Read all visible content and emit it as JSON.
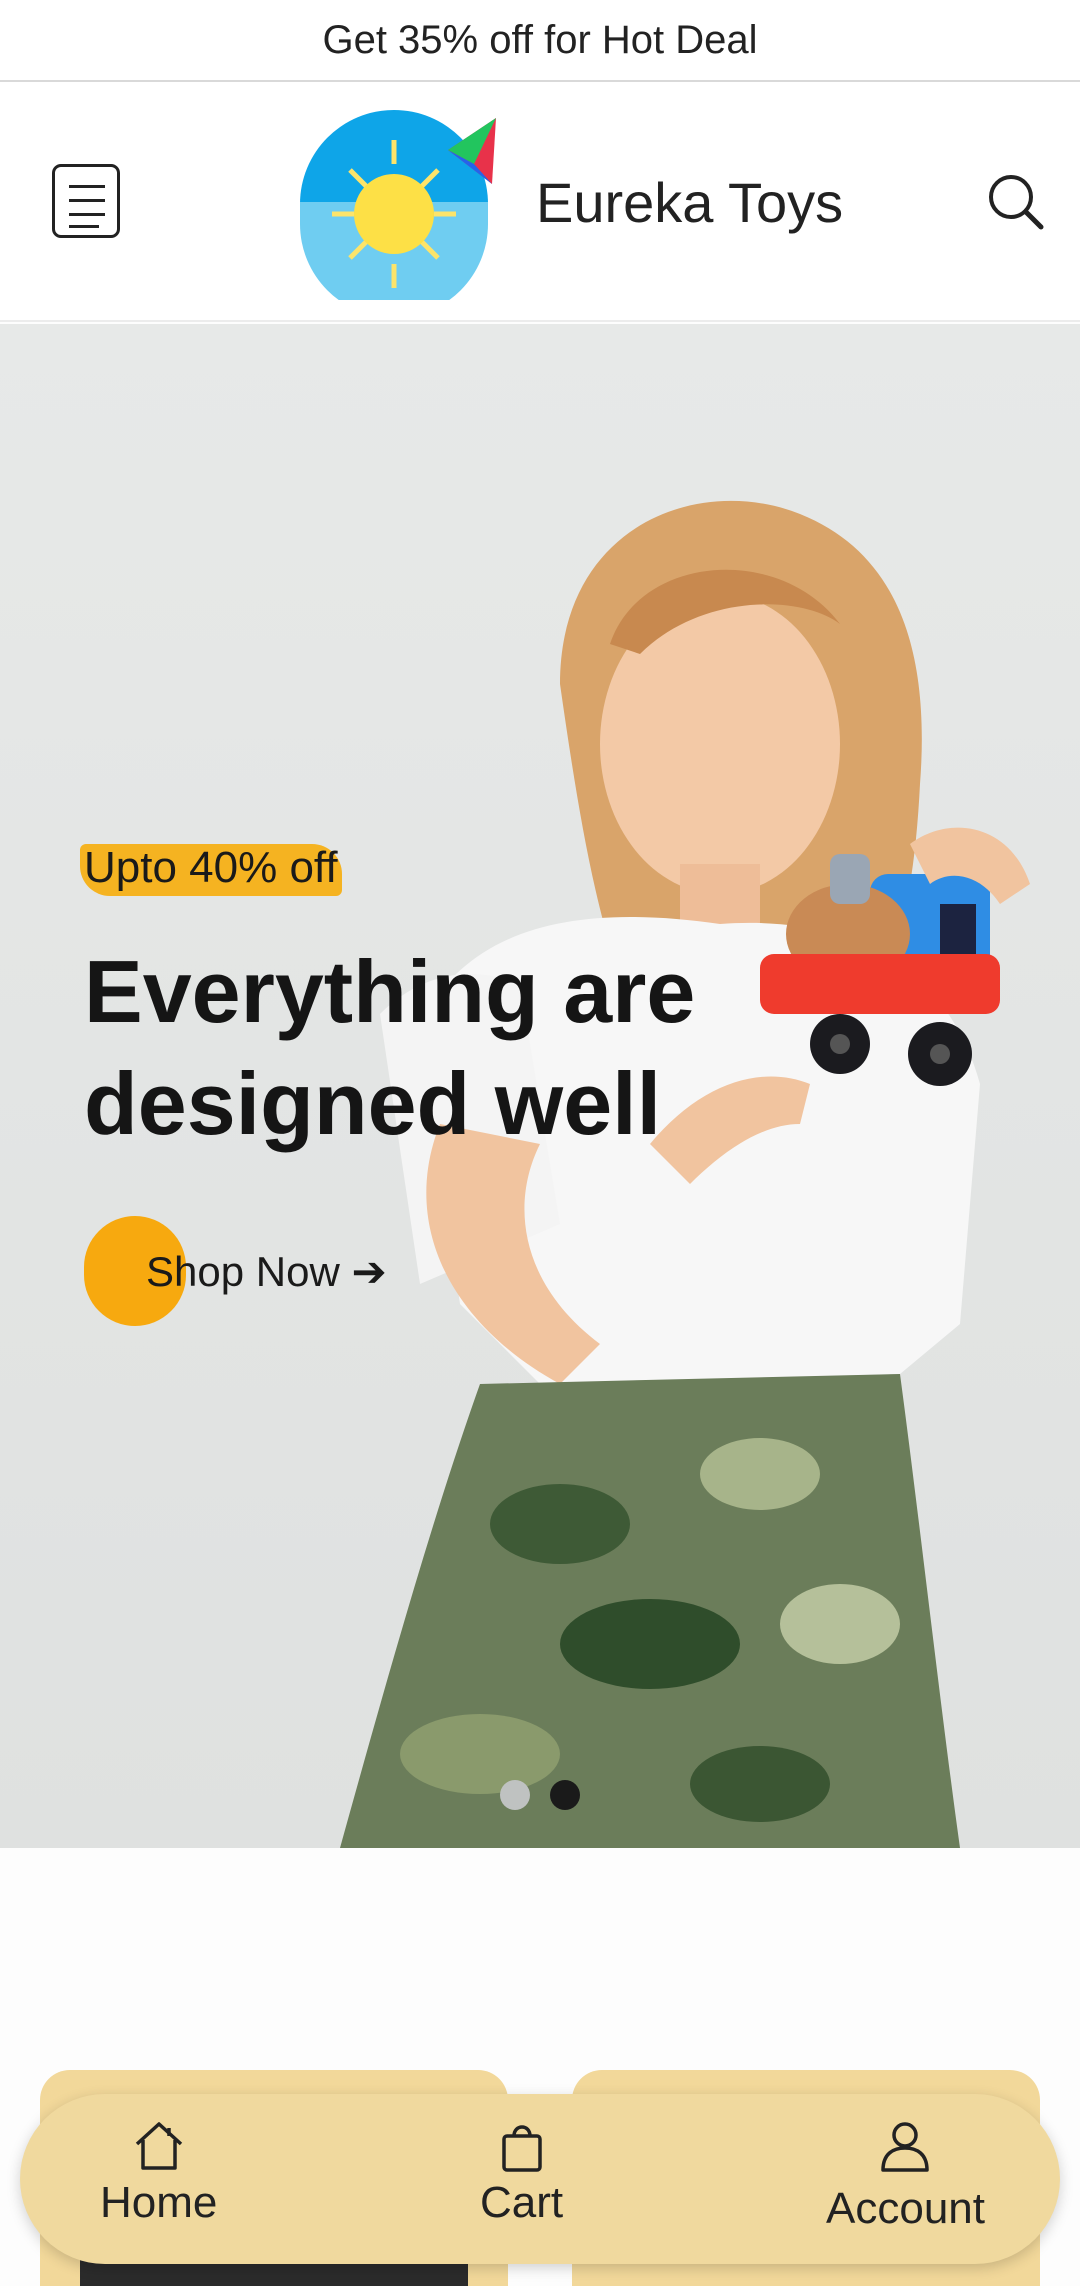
{
  "promo": {
    "text": "Get 35% off for Hot Deal"
  },
  "header": {
    "brand_name": "Eureka Toys",
    "menu_icon": "menu-icon",
    "search_icon": "search-icon"
  },
  "hero": {
    "offer": "Upto 40% off",
    "headline": "Everything are designed well",
    "cta_label": "Shop Now ➔",
    "slides": {
      "count": 2,
      "active": 2
    }
  },
  "colors": {
    "accent": "#f7a90f",
    "highlight": "#f5b321",
    "nav_bg": "#f0d99e",
    "card_bg": "#f2d89a"
  },
  "bottom_nav": {
    "items": [
      {
        "label": "Home",
        "icon": "home-icon"
      },
      {
        "label": "Cart",
        "icon": "bag-icon"
      },
      {
        "label": "Account",
        "icon": "user-icon"
      }
    ]
  }
}
